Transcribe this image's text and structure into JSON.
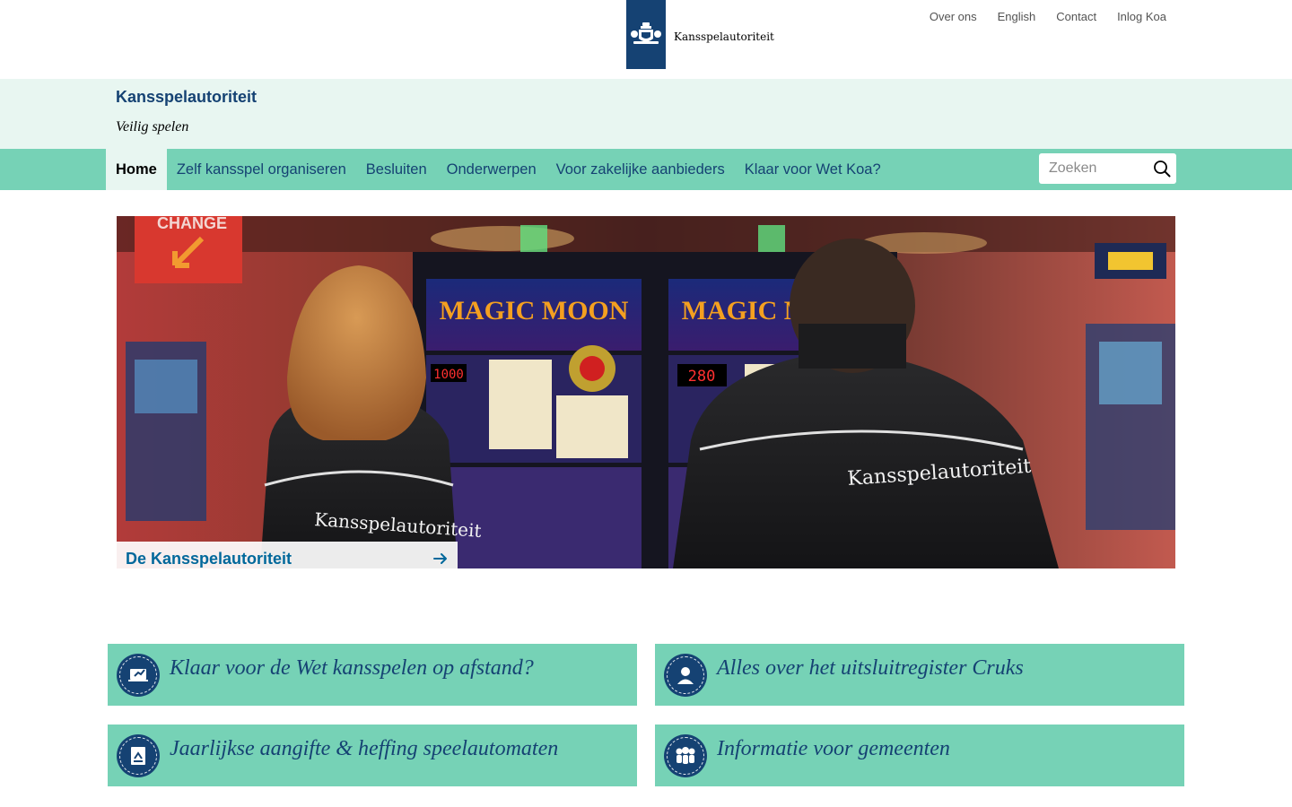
{
  "brand": {
    "logo_text": "Kansspelautoriteit",
    "colors": {
      "primary": "#154273",
      "accent": "#76d2b6",
      "light": "#e8f6f1"
    }
  },
  "service_nav": [
    "Over ons",
    "English",
    "Contact",
    "Inlog Koa"
  ],
  "header": {
    "title": "Kansspelautoriteit",
    "subtitle": "Veilig spelen"
  },
  "main_nav": {
    "items": [
      "Home",
      "Zelf kansspel organiseren",
      "Besluiten",
      "Onderwerpen",
      "Voor zakelijke aanbieders",
      "Klaar voor Wet Koa?"
    ],
    "active": "Home"
  },
  "search": {
    "placeholder": "Zoeken",
    "icon": "search-icon"
  },
  "hero": {
    "caption": "De Kansspelautoriteit",
    "caption_icon": "arrow-right-icon",
    "jacket_text": "Kansspelautoriteit",
    "machine_title_left": "MAGIC MOON",
    "machine_title_right": "MAGIC MOON",
    "display_left": "1000",
    "display_right": "280",
    "sign_text": "CHANGE"
  },
  "tiles": [
    {
      "label": "Klaar voor de Wet kansspelen op afstand?",
      "icon": "laptop-hand-icon"
    },
    {
      "label": "Alles over het uitsluitregister Cruks",
      "icon": "person-icon"
    },
    {
      "label": "Jaarlijkse aangifte & heffing speelautomaten",
      "icon": "document-icon"
    },
    {
      "label": "Informatie voor gemeenten",
      "icon": "group-icon"
    }
  ]
}
